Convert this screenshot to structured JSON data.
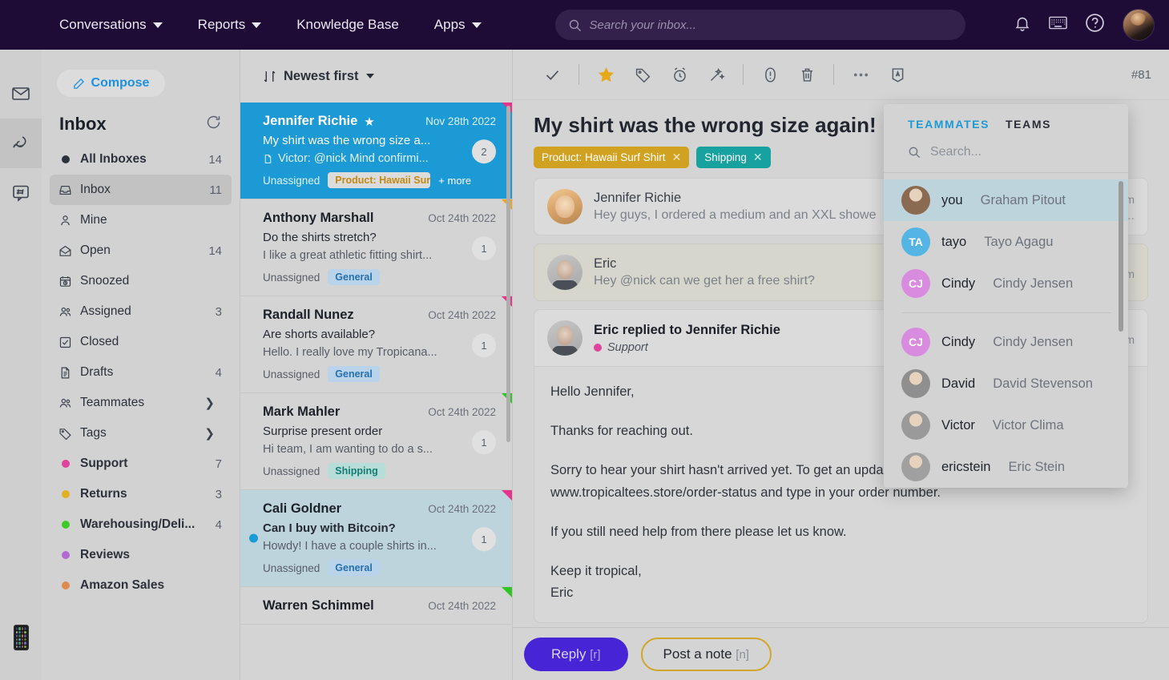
{
  "topnav": {
    "items": [
      {
        "label": "Conversations",
        "caret": true
      },
      {
        "label": "Reports",
        "caret": true
      },
      {
        "label": "Knowledge Base",
        "caret": false
      },
      {
        "label": "Apps",
        "caret": true
      }
    ],
    "search_placeholder": "Search your inbox...",
    "search_value": "",
    "icons": [
      "bell-icon",
      "keyboard-icon",
      "help-icon",
      "user-avatar"
    ]
  },
  "rail": {
    "items": [
      "mail-icon",
      "chat-icon",
      "hash-icon"
    ],
    "bottom": "phone-icon"
  },
  "sidebar": {
    "compose_label": "Compose",
    "title": "Inbox",
    "items": [
      {
        "label": "All Inboxes",
        "count": "14",
        "icon": "filled-dot",
        "bold": true,
        "selected": false
      },
      {
        "label": "Inbox",
        "count": "11",
        "icon": "inbox-icon",
        "bold": false,
        "selected": true
      },
      {
        "label": "Mine",
        "count": "",
        "icon": "person-icon",
        "bold": false,
        "selected": false
      },
      {
        "label": "Open",
        "count": "14",
        "icon": "open-envelope-icon",
        "bold": false,
        "selected": false
      },
      {
        "label": "Snoozed",
        "count": "",
        "icon": "snooze-icon",
        "bold": false,
        "selected": false
      },
      {
        "label": "Assigned",
        "count": "3",
        "icon": "people-icon",
        "bold": false,
        "selected": false
      },
      {
        "label": "Closed",
        "count": "",
        "icon": "check-box-icon",
        "bold": false,
        "selected": false
      },
      {
        "label": "Drafts",
        "count": "4",
        "icon": "document-icon",
        "bold": false,
        "selected": false
      },
      {
        "label": "Teammates",
        "count": "",
        "icon": "people-icon",
        "bold": false,
        "selected": false,
        "chevron": true
      },
      {
        "label": "Tags",
        "count": "",
        "icon": "tag-icon",
        "bold": false,
        "selected": false,
        "chevron": true
      }
    ],
    "folders": [
      {
        "label": "Support",
        "count": "7",
        "color": "#e0439b"
      },
      {
        "label": "Returns",
        "count": "3",
        "color": "#e0b023"
      },
      {
        "label": "Warehousing/Deli...",
        "count": "4",
        "color": "#3ec926"
      },
      {
        "label": "Reviews",
        "count": "",
        "color": "#b16ad4"
      },
      {
        "label": "Amazon Sales",
        "count": "",
        "color": "#e08a4e"
      }
    ]
  },
  "convlist": {
    "sort_label": "Newest first",
    "items": [
      {
        "name": "Jennifer Richie",
        "starred": true,
        "date": "Nov 28th 2022",
        "subject": "My shirt was the wrong size a...",
        "preview": "Victor: @nick Mind confirmi...",
        "preview_icon": "note-icon",
        "assignee": "Unassigned",
        "badge": "2",
        "tag": "Product: Hawaii Surf Shirt",
        "tag_kind": "product",
        "more": "+ more",
        "corner": "#e8338c",
        "state": "selected",
        "unread": false
      },
      {
        "name": "Anthony Marshall",
        "starred": false,
        "date": "Oct 24th 2022",
        "subject": "Do the shirts stretch?",
        "preview": "I like a great athletic fitting shirt...",
        "preview_icon": "",
        "assignee": "Unassigned",
        "badge": "1",
        "tag": "General",
        "tag_kind": "general",
        "more": "",
        "corner": "#e8a81a",
        "state": "",
        "unread": false
      },
      {
        "name": "Randall Nunez",
        "starred": false,
        "date": "Oct 24th 2022",
        "subject": "Are shorts available?",
        "preview": "Hello. I really love my Tropicana...",
        "preview_icon": "",
        "assignee": "Unassigned",
        "badge": "1",
        "tag": "General",
        "tag_kind": "general",
        "more": "",
        "corner": "#e8338c",
        "state": "",
        "unread": false
      },
      {
        "name": "Mark Mahler",
        "starred": false,
        "date": "Oct 24th 2022",
        "subject": "Surprise present order",
        "preview": "Hi team, I am wanting to do a s...",
        "preview_icon": "",
        "assignee": "Unassigned",
        "badge": "1",
        "tag": "Shipping",
        "tag_kind": "shipping",
        "more": "",
        "corner": "#2fc524",
        "state": "",
        "unread": false
      },
      {
        "name": "Cali Goldner",
        "starred": false,
        "date": "Oct 24th 2022",
        "subject": "Can I buy with Bitcoin?",
        "preview": "Howdy! I have a couple shirts in...",
        "preview_icon": "",
        "assignee": "Unassigned",
        "badge": "1",
        "tag": "General",
        "tag_kind": "general",
        "more": "",
        "corner": "#e8338c",
        "state": "highlight",
        "unread": true
      },
      {
        "name": "Warren Schimmel",
        "starred": false,
        "date": "Oct 24th 2022",
        "subject": "",
        "preview": "",
        "preview_icon": "",
        "assignee": "",
        "badge": "",
        "tag": "",
        "tag_kind": "",
        "more": "",
        "corner": "#2fc524",
        "state": "",
        "unread": false
      }
    ]
  },
  "main": {
    "toolbar": {
      "icons": [
        "check-icon",
        "star-icon",
        "tag-icon",
        "snooze-icon",
        "magic-wand-icon",
        "alert-icon",
        "trash-icon",
        "more-icon",
        "assign-icon"
      ],
      "conversation_id": "#81"
    },
    "subject": "My shirt was the wrong size again!",
    "pills": [
      {
        "label": "Product: Hawaii Surf Shirt",
        "color": "#d1a222"
      },
      {
        "label": "Shipping",
        "color": "#17a2a0"
      }
    ],
    "messages": [
      {
        "author": "Jennifer Richie",
        "bold": false,
        "preview": "Hey guys, I ordered a medium and an XXL showe",
        "time": "pm",
        "dots": "...",
        "kind": "message",
        "sub": "",
        "sub_color": ""
      },
      {
        "author": "Eric",
        "bold": false,
        "preview": "Hey @nick can we get her a free shirt?",
        "time": "pm",
        "dots": "",
        "kind": "note",
        "sub": "",
        "sub_color": ""
      },
      {
        "author": "Eric replied to Jennifer Richie",
        "bold": true,
        "preview": "",
        "time": "pm",
        "dots": "",
        "kind": "opened",
        "sub": "Support",
        "sub_color": "#e0439b"
      }
    ],
    "mail_body": [
      "Hello Jennifer,",
      "Thanks for reaching out.",
      "Sorry to hear your shirt hasn't arrived yet.  To get an update on your order status, please visit www.tropicaltees.store/order-status and type in your order number.",
      "If you still need help from there please let us know.",
      "Keep it tropical,\nEric"
    ],
    "composer": {
      "reply_label": "Reply",
      "reply_key": "[r]",
      "note_label": "Post a note",
      "note_key": "[n]"
    }
  },
  "dropdown": {
    "tabs": [
      {
        "label": "TEAMMATES",
        "active": true
      },
      {
        "label": "TEAMS",
        "active": false
      }
    ],
    "search_placeholder": "Search...",
    "search_value": "",
    "recent": [
      {
        "handle": "you",
        "full": "Graham Pitout",
        "initials": "",
        "color": "#8a6a50",
        "photo": true,
        "selected": true
      },
      {
        "handle": "tayo",
        "full": "Tayo Agagu",
        "initials": "TA",
        "color": "#54b4e4",
        "photo": false,
        "selected": false
      },
      {
        "handle": "Cindy",
        "full": "Cindy Jensen",
        "initials": "CJ",
        "color": "#d98be0",
        "photo": false,
        "selected": false
      }
    ],
    "all": [
      {
        "handle": "Cindy",
        "full": "Cindy Jensen",
        "initials": "CJ",
        "color": "#d98be0",
        "photo": false,
        "selected": false
      },
      {
        "handle": "David",
        "full": "David Stevenson",
        "initials": "",
        "color": "#8f8f8f",
        "photo": true,
        "selected": false
      },
      {
        "handle": "Victor",
        "full": "Victor Clima",
        "initials": "",
        "color": "#9a9a9a",
        "photo": true,
        "selected": false
      },
      {
        "handle": "ericstein",
        "full": "Eric Stein",
        "initials": "",
        "color": "#a0a0a0",
        "photo": true,
        "selected": false
      }
    ]
  }
}
